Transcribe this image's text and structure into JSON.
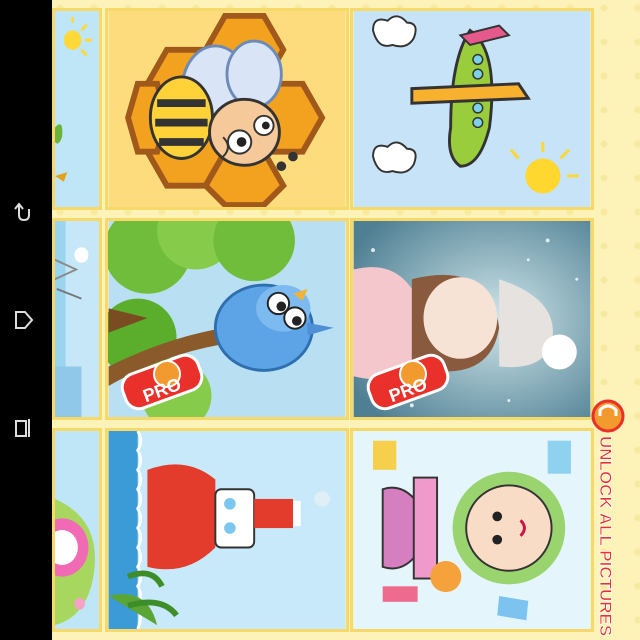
{
  "nav": {
    "back_icon": "back-icon",
    "home_icon": "home-icon",
    "recents_icon": "recents-icon"
  },
  "pictures": [
    {
      "id": "sun-partial",
      "subject": "sun",
      "locked": false
    },
    {
      "id": "bee",
      "subject": "bee on honeycomb",
      "locked": false
    },
    {
      "id": "airplane",
      "subject": "airplane",
      "locked": false
    },
    {
      "id": "bridge-partial",
      "subject": "bridge",
      "locked": false
    },
    {
      "id": "bird",
      "subject": "blue bird",
      "locked": true
    },
    {
      "id": "girl",
      "subject": "girl in winter hat",
      "locked": true
    },
    {
      "id": "flower-partial",
      "subject": "flower",
      "locked": false
    },
    {
      "id": "boat",
      "subject": "boat",
      "locked": false
    },
    {
      "id": "baby",
      "subject": "baby",
      "locked": false
    }
  ],
  "badges": {
    "pro_label": "PRO"
  },
  "unlock": {
    "label": "UNLOCK ALL PICTURES"
  },
  "colors": {
    "background": "#fdf2b8",
    "frame": "#f7d96a",
    "badge_red": "#e9302a",
    "accent_orange": "#f29a2e"
  }
}
